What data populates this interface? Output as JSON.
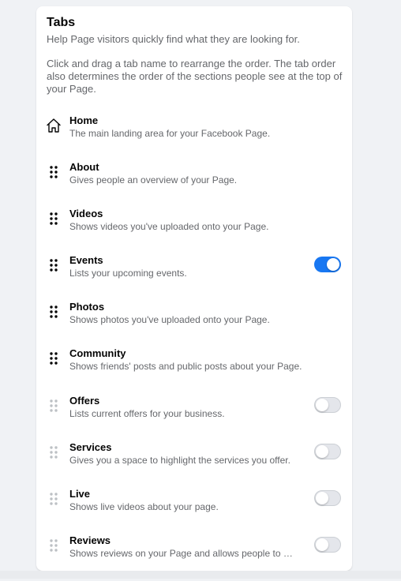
{
  "header": {
    "title": "Tabs",
    "subtitle": "Help Page visitors quickly find what they are looking for.",
    "description": "Click and drag a tab name to rearrange the order. The tab order also determines the order of the sections people see at the top of your Page."
  },
  "tabs": [
    {
      "name": "Home",
      "description": "The main landing area for your Facebook Page.",
      "icon": "home-icon",
      "toggle": null
    },
    {
      "name": "About",
      "description": "Gives people an overview of your Page.",
      "icon": "drag-handle-icon",
      "toggle": null
    },
    {
      "name": "Videos",
      "description": "Shows videos you've uploaded onto your Page.",
      "icon": "drag-handle-icon",
      "toggle": null
    },
    {
      "name": "Events",
      "description": "Lists your upcoming events.",
      "icon": "drag-handle-icon",
      "toggle": "on"
    },
    {
      "name": "Photos",
      "description": "Shows photos you've uploaded onto your Page.",
      "icon": "drag-handle-icon",
      "toggle": null
    },
    {
      "name": "Community",
      "description": "Shows friends' posts and public posts about your Page.",
      "icon": "drag-handle-icon",
      "toggle": null
    },
    {
      "name": "Offers",
      "description": "Lists current offers for your business.",
      "icon": "drag-handle-icon-disabled",
      "toggle": "off"
    },
    {
      "name": "Services",
      "description": "Gives you a space to highlight the services you offer.",
      "icon": "drag-handle-icon-disabled",
      "toggle": "off"
    },
    {
      "name": "Live",
      "description": "Shows live videos about your page.",
      "icon": "drag-handle-icon-disabled",
      "toggle": "off"
    },
    {
      "name": "Reviews",
      "description": "Shows reviews on your Page and allows people to write reviews.",
      "icon": "drag-handle-icon-disabled",
      "toggle": "off"
    }
  ],
  "colors": {
    "accent": "#1877f2",
    "text_primary": "#050505",
    "text_secondary": "#65676b",
    "handle_active": "#050505",
    "handle_disabled": "#bcc0c4",
    "background": "#f0f2f5"
  }
}
